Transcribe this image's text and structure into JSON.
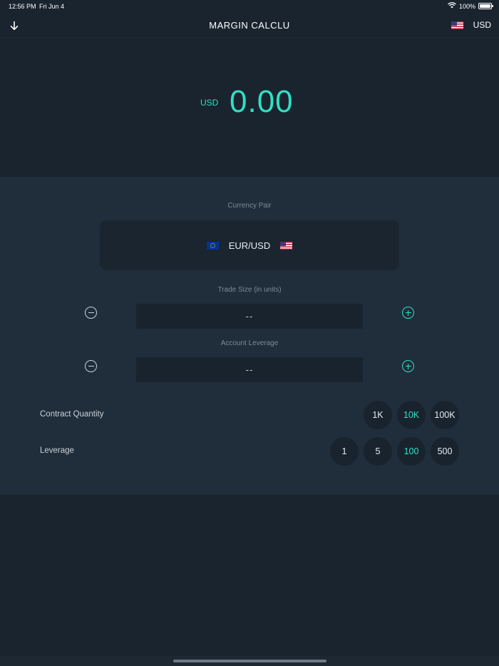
{
  "status": {
    "time": "12:56 PM",
    "date": "Fri Jun 4",
    "battery": "100%",
    "icons": [
      "wifi-icon",
      "battery-icon"
    ]
  },
  "nav": {
    "back_icon": "arrow-down-icon",
    "title": "MARGIN CALCLU",
    "currency": "USD",
    "currency_flag": "us-flag-icon"
  },
  "result": {
    "currency": "USD",
    "value": "0.00"
  },
  "form": {
    "currency_pair_label": "Currency Pair",
    "currency_pair": "EUR/USD",
    "base_flag": "eu-flag-icon",
    "quote_flag": "us-flag-icon",
    "trade_size_label": "Trade Size (in units)",
    "trade_size_value": "--",
    "account_leverage_label": "Account Leverage",
    "account_leverage_value": "--"
  },
  "contract_quantity": {
    "label": "Contract Quantity",
    "options": [
      "1K",
      "10K",
      "100K"
    ],
    "selected": "10K"
  },
  "leverage": {
    "label": "Leverage",
    "options": [
      "1",
      "5",
      "100",
      "500"
    ],
    "selected": "100"
  },
  "colors": {
    "accent": "#2fe0c3",
    "background": "#19242f",
    "panel": "#202d3a",
    "field": "#18232e"
  }
}
